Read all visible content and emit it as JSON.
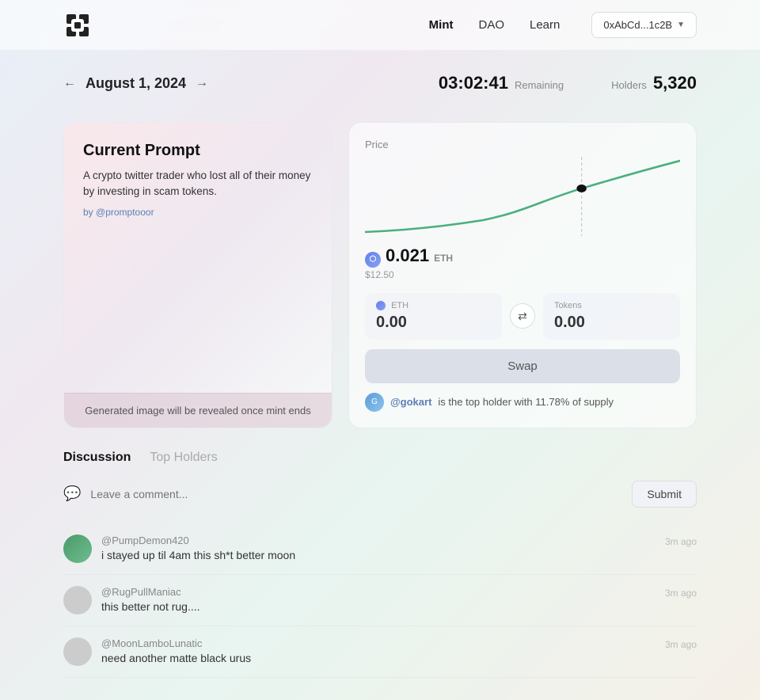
{
  "nav": {
    "logo_alt": "logo",
    "links": [
      {
        "label": "Mint",
        "id": "mint",
        "active": true
      },
      {
        "label": "DAO",
        "id": "dao",
        "active": false
      },
      {
        "label": "Learn",
        "id": "learn",
        "active": false
      }
    ],
    "wallet": "0xAbCd...1c2B"
  },
  "date": {
    "display": "August 1, 2024",
    "prev_arrow": "←",
    "next_arrow": "→"
  },
  "stats": {
    "timer": "03:02:41",
    "timer_label": "Remaining",
    "holders_label": "Holders",
    "holders_value": "5,320"
  },
  "prompt_card": {
    "title": "Current Prompt",
    "description": "A crypto twitter trader who lost all of their money by investing in scam tokens.",
    "author_prefix": "by",
    "author": "@promptooor",
    "reveal_text": "Generated image will be revealed once mint ends"
  },
  "price_card": {
    "price_label": "Price",
    "eth_value": "0.021",
    "eth_unit": "ETH",
    "usd_value": "$12.50",
    "eth_input_label": "ETH",
    "eth_input_value": "0.00",
    "tokens_input_label": "Tokens",
    "tokens_input_value": "0.00",
    "swap_arrow": "⇄",
    "swap_btn_label": "Swap",
    "top_holder_text": "is the top holder with 11.78% of supply",
    "top_holder_username": "@gokart"
  },
  "discussion": {
    "tab_active": "Discussion",
    "tab_inactive": "Top Holders",
    "comment_placeholder": "Leave a comment...",
    "submit_label": "Submit",
    "comments": [
      {
        "username": "@PumpDemon420",
        "text": "i stayed up til 4am this sh*t better moon",
        "time": "3m ago",
        "avatar_color": "green"
      },
      {
        "username": "@RugPullManiac",
        "text": "this better not rug....",
        "time": "3m ago",
        "avatar_color": "gray"
      },
      {
        "username": "@MoonLamboLunatic",
        "text": "need another matte black urus",
        "time": "3m ago",
        "avatar_color": "gray"
      }
    ]
  },
  "chart": {
    "curve_color": "#4caf7d",
    "dot_color": "#111"
  }
}
